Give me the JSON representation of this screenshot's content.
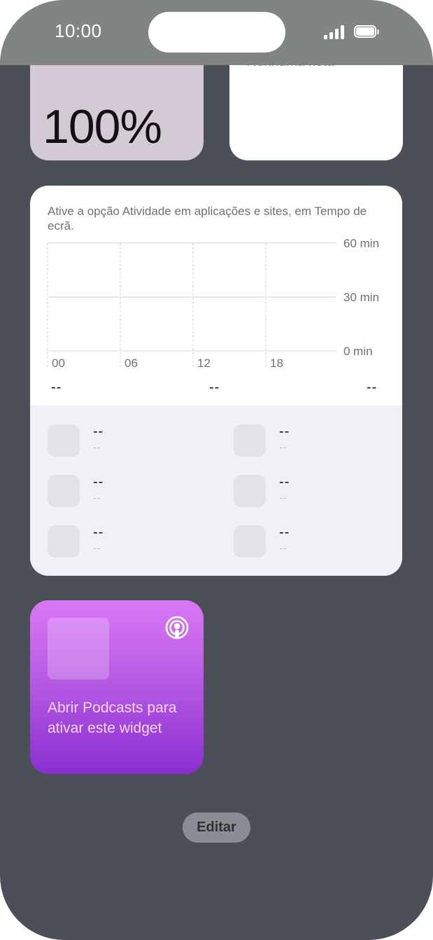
{
  "status_bar": {
    "time": "10:00"
  },
  "battery_widget": {
    "percentage": "100%",
    "ring_color": "#3fb55d"
  },
  "notes_widget": {
    "text": "Nenhuma nota"
  },
  "screen_time_widget": {
    "message": "Ative a opção Atividade em aplicações e sites, em Tempo de ecrã.",
    "chart_data": {
      "type": "bar",
      "categories": [
        "00",
        "06",
        "12",
        "18"
      ],
      "values": [],
      "y_tick_labels": [
        "60 min",
        "30 min",
        "0 min"
      ],
      "ylim": [
        0,
        60
      ],
      "grid": true
    },
    "totals": [
      "--",
      "--",
      "--"
    ],
    "apps": [
      {
        "name": "--",
        "time": "--"
      },
      {
        "name": "--",
        "time": "--"
      },
      {
        "name": "--",
        "time": "--"
      },
      {
        "name": "--",
        "time": "--"
      },
      {
        "name": "--",
        "time": "--"
      },
      {
        "name": "--",
        "time": "--"
      }
    ]
  },
  "podcasts_widget": {
    "message": "Abrir Podcasts para ativar este widget",
    "icon": "podcasts-icon",
    "accent_color": "#b458e3"
  },
  "edit_button": {
    "label": "Editar"
  }
}
